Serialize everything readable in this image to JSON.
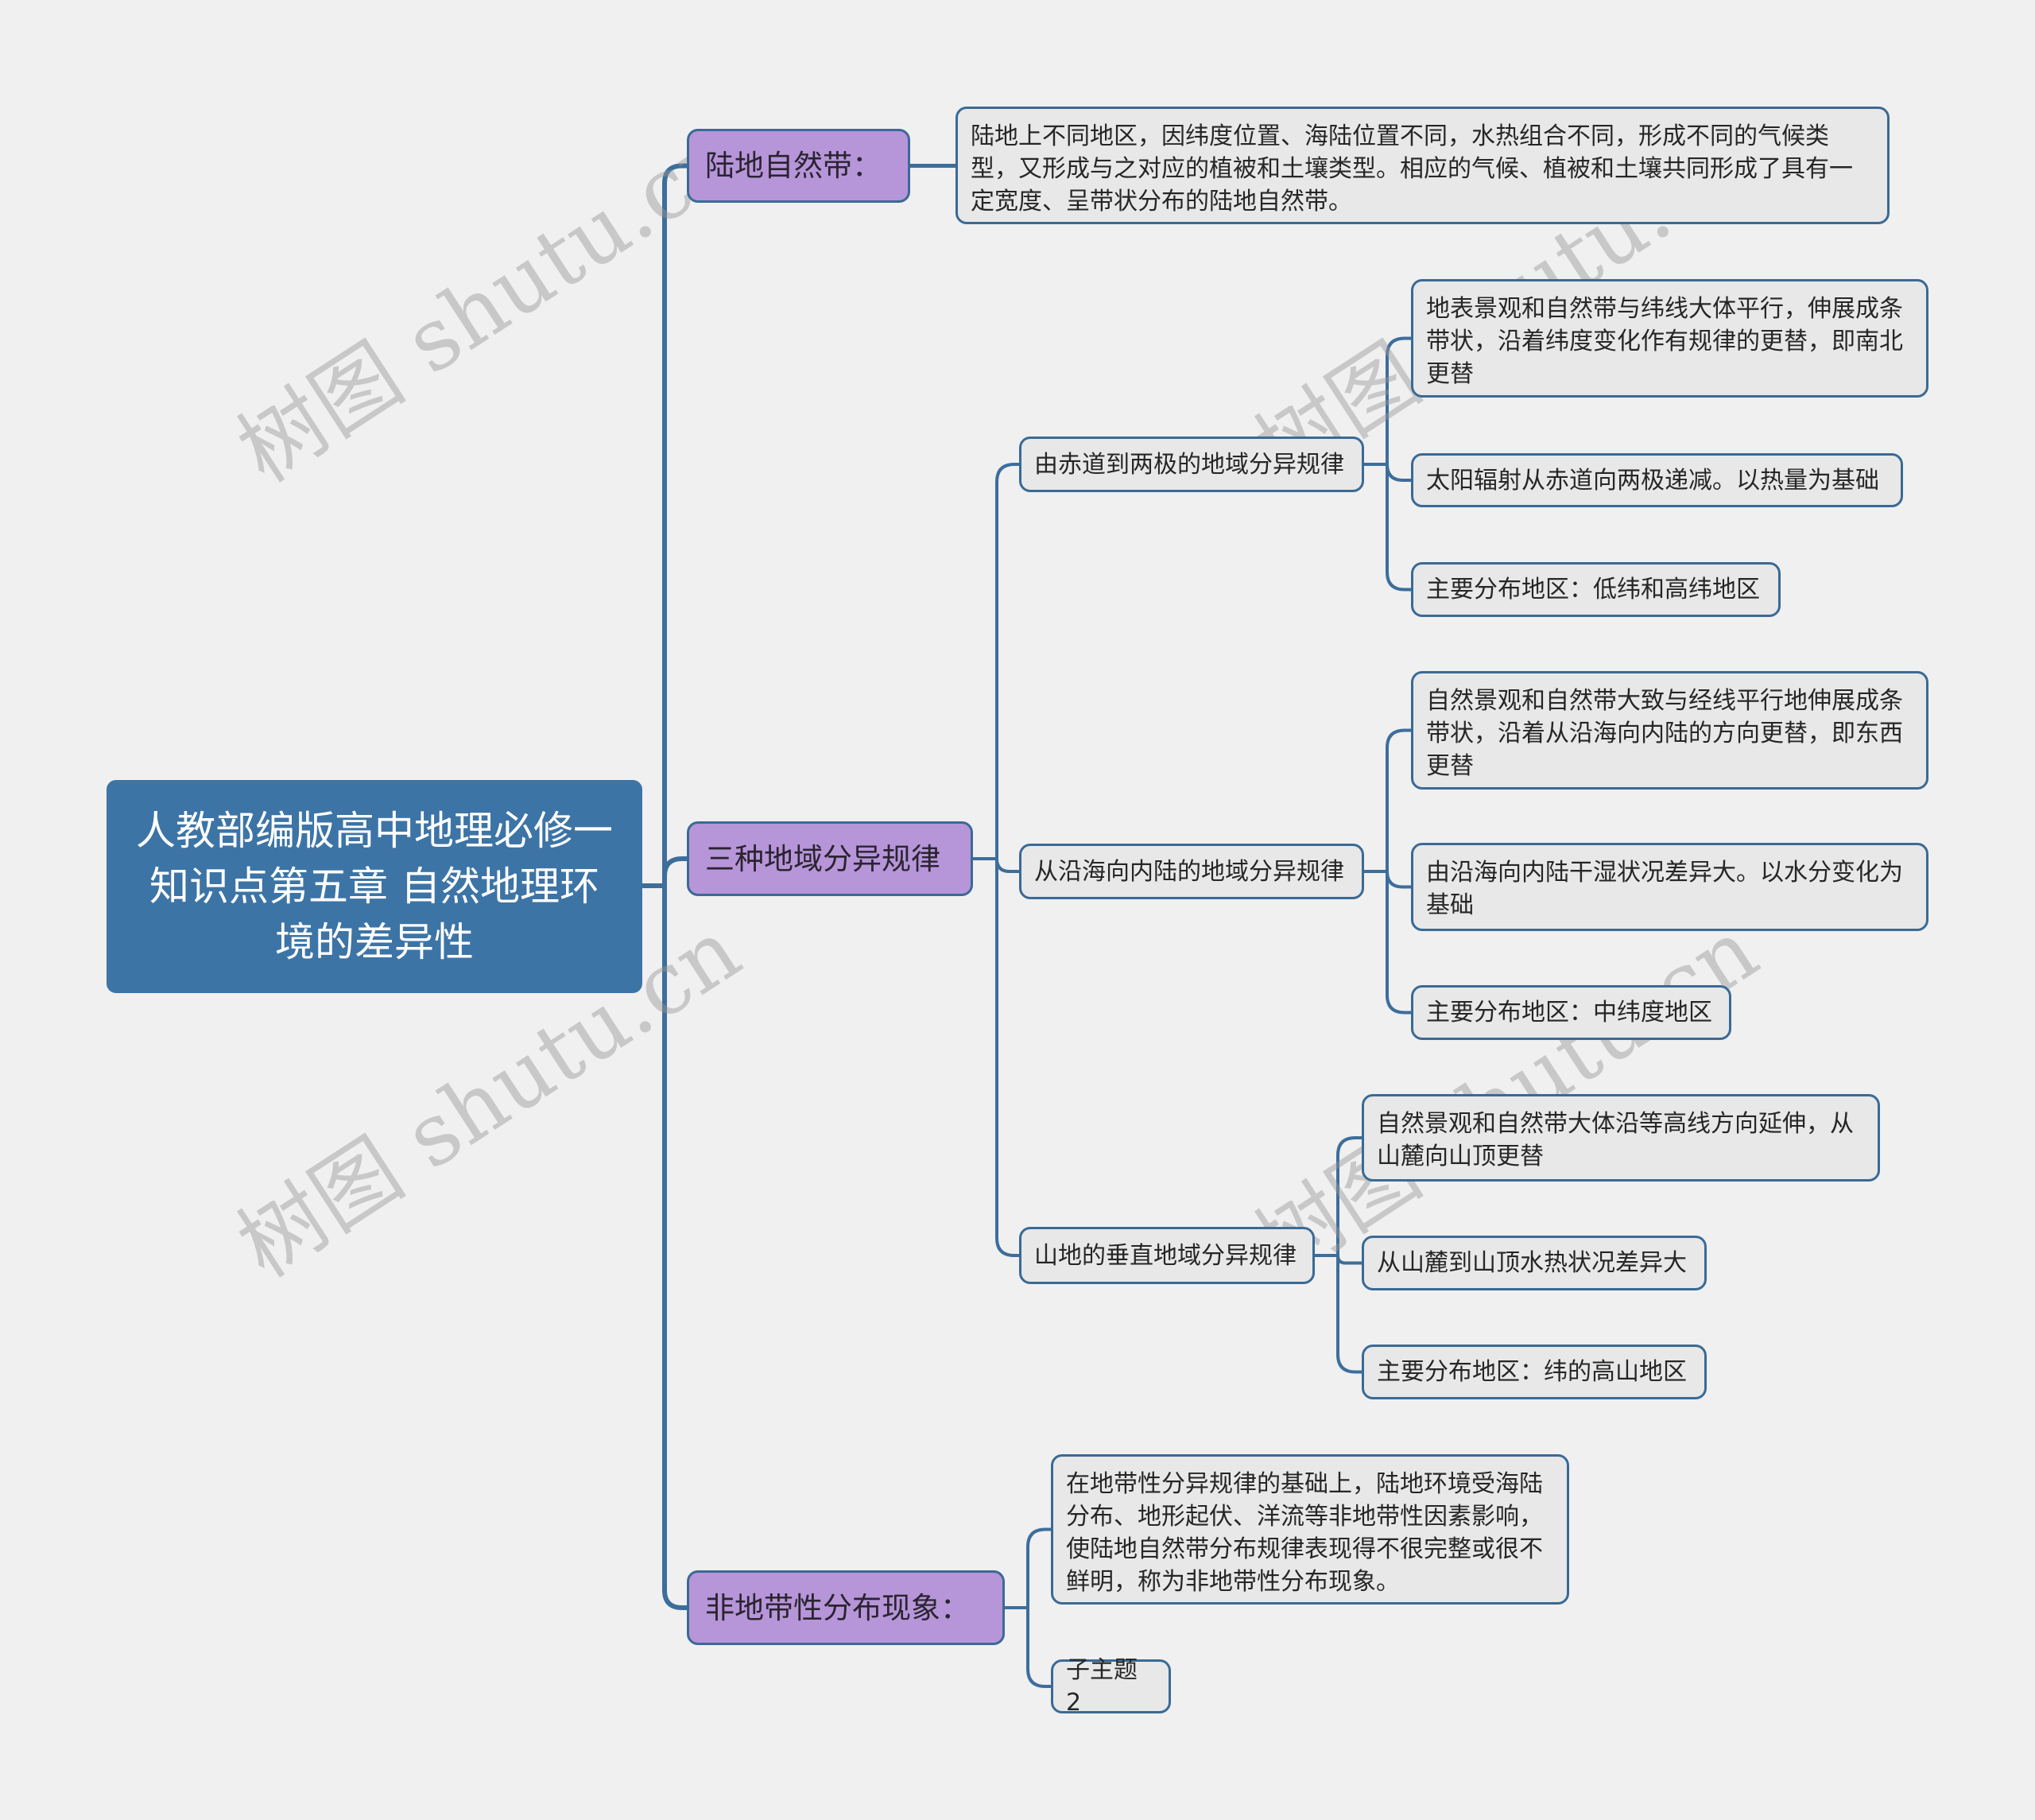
{
  "root": {
    "title": "人教部编版高中地理必修一知识点第五章 自然地理环境的差异性"
  },
  "branches": [
    {
      "label": "陆地自然带：",
      "children": [
        {
          "text": "陆地上不同地区，因纬度位置、海陆位置不同，水热组合不同，形成不同的气候类型，又形成与之对应的植被和土壤类型。相应的气候、植被和土壤共同形成了具有一定宽度、呈带状分布的陆地自然带。"
        }
      ]
    },
    {
      "label": "三种地域分异规律",
      "children": [
        {
          "text": "由赤道到两极的地域分异规律",
          "children": [
            {
              "text": "地表景观和自然带与纬线大体平行，伸展成条带状，沿着纬度变化作有规律的更替，即南北更替"
            },
            {
              "text": "太阳辐射从赤道向两极递减。以热量为基础"
            },
            {
              "text": "主要分布地区：低纬和高纬地区"
            }
          ]
        },
        {
          "text": "从沿海向内陆的地域分异规律",
          "children": [
            {
              "text": "自然景观和自然带大致与经线平行地伸展成条带状，沿着从沿海向内陆的方向更替，即东西更替"
            },
            {
              "text": "由沿海向内陆干湿状况差异大。以水分变化为基础"
            },
            {
              "text": "主要分布地区：中纬度地区"
            }
          ]
        },
        {
          "text": "山地的垂直地域分异规律",
          "children": [
            {
              "text": "自然景观和自然带大体沿等高线方向延伸，从山麓向山顶更替"
            },
            {
              "text": "从山麓到山顶水热状况差异大"
            },
            {
              "text": "主要分布地区：纬的高山地区"
            }
          ]
        }
      ]
    },
    {
      "label": "非地带性分布现象：",
      "children": [
        {
          "text": "在地带性分异规律的基础上，陆地环境受海陆分布、地形起伏、洋流等非地带性因素影响，使陆地自然带分布规律表现得不很完整或很不鲜明，称为非地带性分布现象。"
        },
        {
          "text": "子主题 2"
        }
      ]
    }
  ],
  "watermark": "树图 shutu.cn",
  "colors": {
    "background": "#f0f0f0",
    "root_fill": "#3d74a6",
    "branch_fill": "#b795d9",
    "leaf_fill": "#e8e8e8",
    "connector": "#3c6e9c"
  }
}
